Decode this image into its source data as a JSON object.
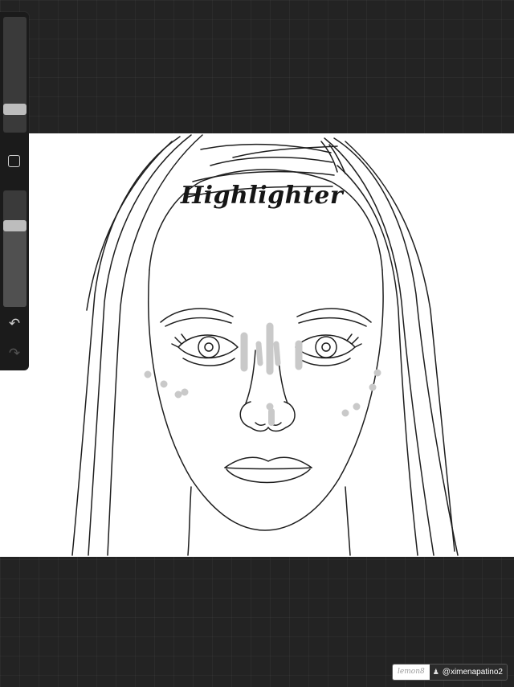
{
  "canvas": {
    "annotation_text": "Highlighter"
  },
  "toolbar": {
    "brush_size_level": 0.17,
    "opacity_level": 0.72,
    "modify_button_icon": "square-icon",
    "undo_icon": "undo-arrow-icon",
    "redo_icon": "redo-arrow-icon",
    "undo_glyph": "↶",
    "redo_glyph": "↷",
    "undo_enabled": true,
    "redo_enabled": false
  },
  "watermark": {
    "brand": "lemon8",
    "username": "@ximenapatino2",
    "user_icon": "person-icon"
  },
  "colors": {
    "app_background": "#232323",
    "toolbar_background": "#1b1b1b",
    "highlighter_marks": "#c9c9c9",
    "line_art": "#1e1e1e",
    "artwork_paper": "#ffffff"
  }
}
